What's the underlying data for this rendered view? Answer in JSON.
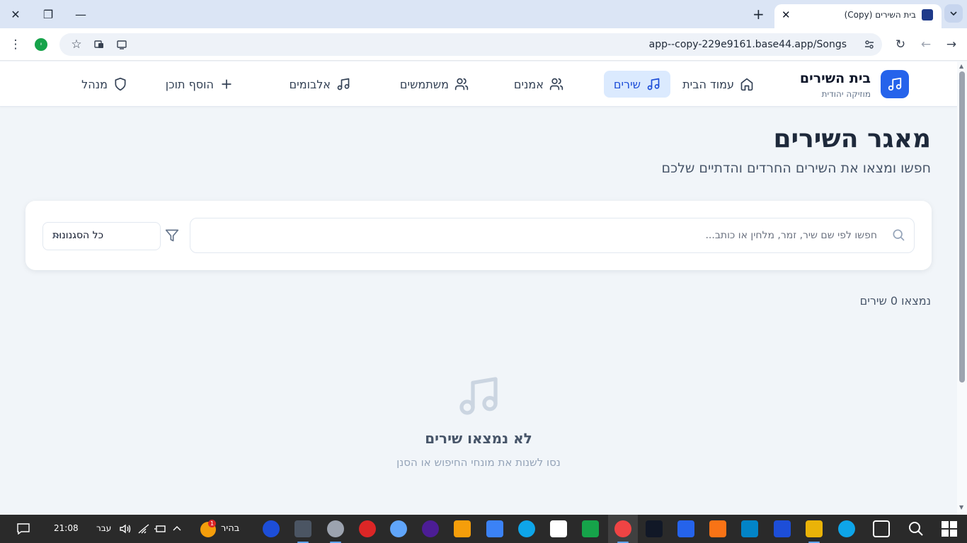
{
  "browser": {
    "tab_title": "בית השירים (Copy)",
    "url": "app--copy-229e9161.base44.app/Songs",
    "profile_initial": "י"
  },
  "app": {
    "brand_title": "בית השירים",
    "brand_subtitle": "מוזיקה יהודית",
    "accent_color": "#2563eb",
    "nav": [
      {
        "label": "עמוד הבית",
        "icon": "home-icon",
        "active": false
      },
      {
        "label": "שירים",
        "icon": "music-note-icon",
        "active": true
      },
      {
        "label": "אמנים",
        "icon": "users-icon",
        "active": false
      },
      {
        "label": "משתמשים",
        "icon": "users-icon",
        "active": false
      },
      {
        "label": "אלבומים",
        "icon": "music-note-icon",
        "active": false
      },
      {
        "label": "הוסף תוכן",
        "icon": "plus-icon",
        "active": false
      },
      {
        "label": "מנהל",
        "icon": "shield-icon",
        "active": false
      }
    ]
  },
  "page": {
    "title": "מאגר השירים",
    "subtitle": "חפשו ומצאו את השירים החרדים והדתיים שלכם",
    "search_placeholder": "חפשו לפי שם שיר, זמר, מלחין או כותב...",
    "genre_select": "כל הסגנונות",
    "results_count": "נמצאו 0 שירים",
    "empty_title": "לא נמצאו שירים",
    "empty_subtitle": "נסו לשנות את מונחי החיפוש או הסנן"
  },
  "taskbar": {
    "time": "21:08",
    "language": "עבר",
    "weather_label": "בהיר",
    "weather_badge": "1"
  }
}
